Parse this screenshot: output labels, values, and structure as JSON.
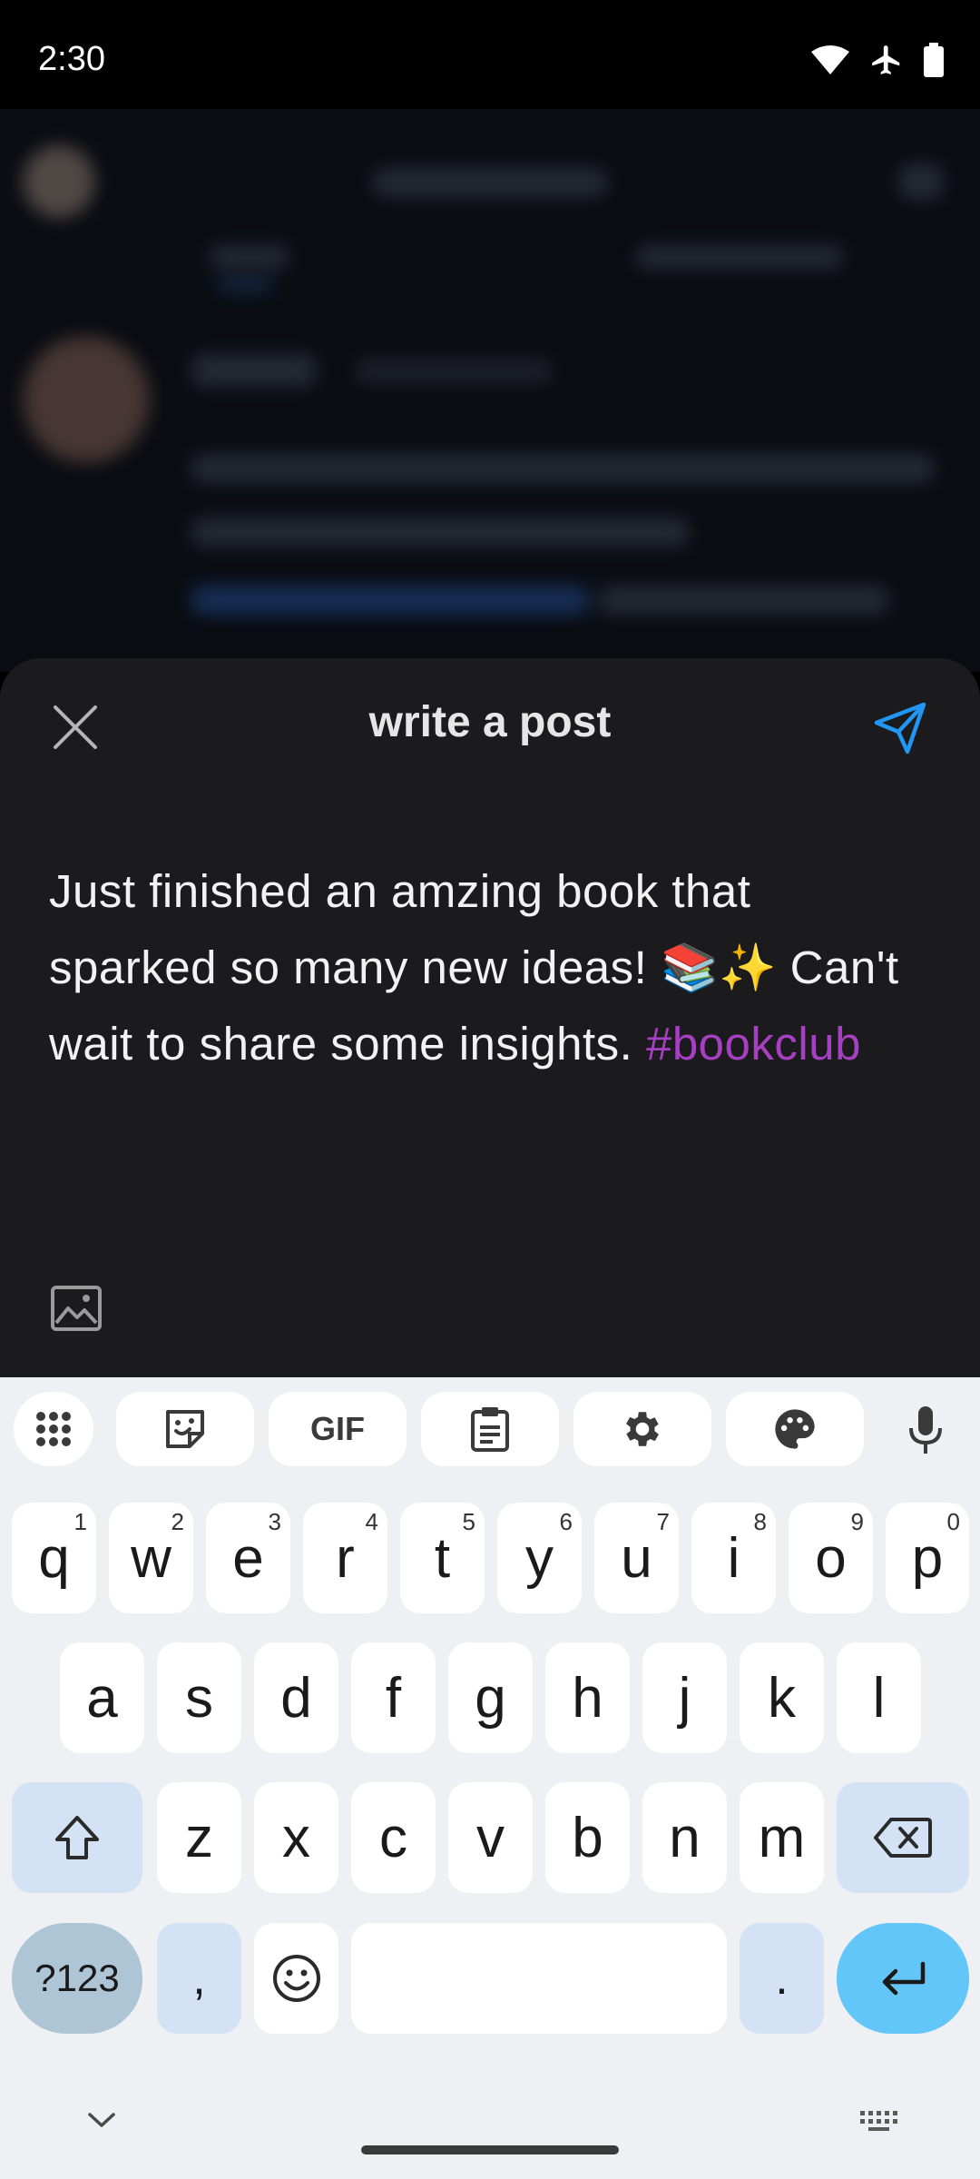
{
  "status_bar": {
    "time": "2:30"
  },
  "compose": {
    "title": "write a post",
    "text_main": "Just finished an amzing book that sparked so many new ideas! 📚✨ Can't wait to share some insights. ",
    "hashtag": "#bookclub"
  },
  "keyboard": {
    "row1": [
      {
        "key": "q",
        "hint": "1"
      },
      {
        "key": "w",
        "hint": "2"
      },
      {
        "key": "e",
        "hint": "3"
      },
      {
        "key": "r",
        "hint": "4"
      },
      {
        "key": "t",
        "hint": "5"
      },
      {
        "key": "y",
        "hint": "6"
      },
      {
        "key": "u",
        "hint": "7"
      },
      {
        "key": "i",
        "hint": "8"
      },
      {
        "key": "o",
        "hint": "9"
      },
      {
        "key": "p",
        "hint": "0"
      }
    ],
    "row2": [
      "a",
      "s",
      "d",
      "f",
      "g",
      "h",
      "j",
      "k",
      "l"
    ],
    "row3": [
      "z",
      "x",
      "c",
      "v",
      "b",
      "n",
      "m"
    ],
    "symbols_label": "?123",
    "comma": ",",
    "period": ".",
    "toolbar": [
      "grid-icon",
      "sticker-icon",
      "gif-button",
      "clipboard-icon",
      "settings-icon",
      "palette-icon",
      "mic-icon"
    ],
    "gif_label": "GIF"
  },
  "colors": {
    "accent": "#2196f3",
    "hashtag": "#a73fc3",
    "sheet": "#1b1b1d",
    "enter": "#63c6f8"
  }
}
